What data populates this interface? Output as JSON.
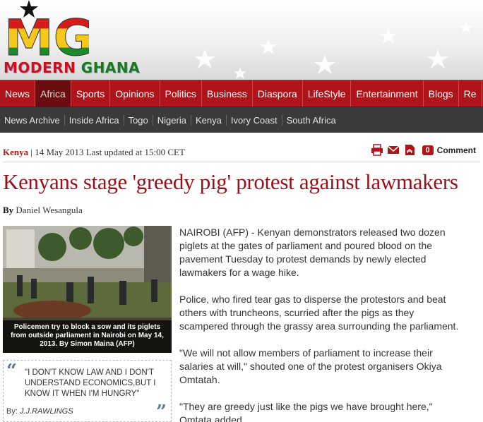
{
  "site": {
    "logo_text_left": "MODERN",
    "logo_text_right": "GHANA",
    "logo_mark": "MG"
  },
  "mainnav": [
    "News",
    "Africa",
    "Sports",
    "Opinions",
    "Politics",
    "Business",
    "Diaspora",
    "LifeStyle",
    "Entertainment",
    "Blogs",
    "Re"
  ],
  "subnav": [
    "News Archive",
    "Inside Africa",
    "Togo",
    "Nigeria",
    "Kenya",
    "Ivory Coast",
    "South Africa"
  ],
  "article": {
    "section": "Kenya",
    "date_line": "| 14 May 2013 Last updated at 15:00 CET",
    "comment_count": "0",
    "comment_label": "Comment",
    "title": "Kenyans stage 'greedy pig' protest against lawmakers",
    "by_label": "By",
    "author": "Daniel Wesangula",
    "photo_caption": "Policemen try to block a sow and its piglets from outside parliament in Nairobi on May 14, 2013. By Simon Maina (AFP)",
    "paragraphs": [
      "NAIROBI (AFP) - Kenyan demonstrators released two dozen piglets at the gates of parliament and poured blood on the pavement Tuesday to protest demands by newly elected lawmakers for a wage hike.",
      "Police, who fired tear gas to disperse the protestors and beat others with truncheons, scurried after the pigs as they scampered through the grassy area surrounding the parliament.",
      "\"We will not allow members of parliament to increase their salaries at will,\" shouted one of the protest organisers Okiya Omtatah.",
      "\"They are greedy just like the pigs we have brought here,\" Omtata added."
    ]
  },
  "quote": {
    "text": "\"I DON'T KNOW LAW AND I DON'T UNDERSTAND ECONOMICS,BUT I KNOW IT WHEN I'M HUNGRY\"",
    "by_label": "By:",
    "author": "J.J.RAWLINGS"
  },
  "icons": [
    "print-icon",
    "email-icon",
    "pdf-icon",
    "comment-icon"
  ],
  "colors": {
    "brand_red": "#b0141b",
    "title_red": "#9a1018",
    "subnav_bg": "#3a3a3a"
  }
}
